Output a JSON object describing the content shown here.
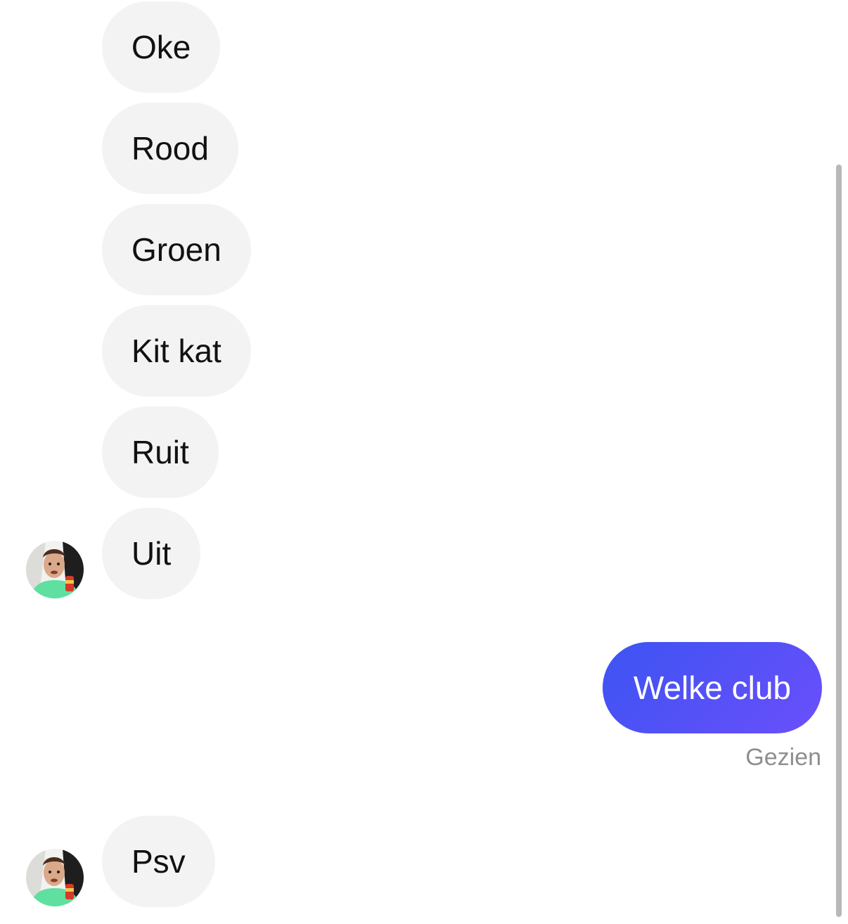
{
  "thread": {
    "incoming": [
      {
        "text": "Oke"
      },
      {
        "text": "Rood"
      },
      {
        "text": "Groen"
      },
      {
        "text": "Kit kat"
      },
      {
        "text": "Ruit"
      },
      {
        "text": "Uit"
      },
      {
        "text": "Psv"
      }
    ],
    "outgoing": [
      {
        "text": "Welke club"
      }
    ],
    "seen_label": "Gezien"
  },
  "colors": {
    "incoming_bubble": "#f3f3f3",
    "outgoing_gradient_start": "#3c54f2",
    "outgoing_gradient_end": "#6b4ffb",
    "seen_text": "#8e8e8e"
  },
  "icons": {
    "avatar": "profile-avatar-icon"
  }
}
